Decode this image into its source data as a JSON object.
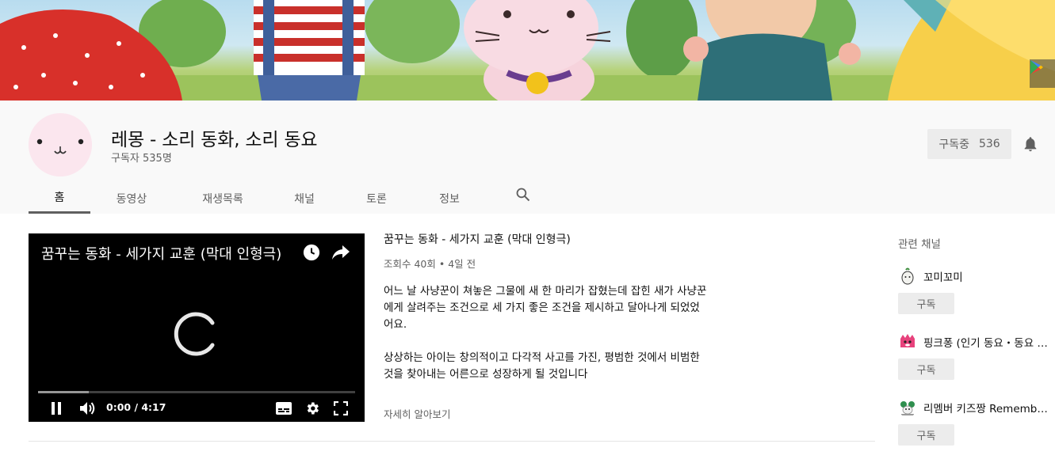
{
  "channel": {
    "name": "레몽 - 소리 동화, 소리 동요",
    "subscribers": "구독자 535명",
    "subscribe_label": "구독중",
    "subscribe_count": "536"
  },
  "tabs": [
    {
      "label": "홈",
      "active": true
    },
    {
      "label": "동영상"
    },
    {
      "label": "재생목록"
    },
    {
      "label": "채널"
    },
    {
      "label": "토론"
    },
    {
      "label": "정보"
    }
  ],
  "player": {
    "title": "꿈꾸는 동화 - 세가지 교훈 (막대 인형극)",
    "time": "0:00 / 4:17",
    "progress": 0.16
  },
  "video": {
    "title": "꿈꾸는 동화 - 세가지 교훈 (막대 인형극)",
    "meta": "조회수 40회 • 4일 전",
    "description": [
      "어느 날 사냥꾼이 쳐놓은 그물에 새 한 마리가 잡혔는데 잡힌 새가 사냥꾼에게 살려주는 조건으로 세 가지 좋은 조건을 제시하고 달아나게 되었었어요.",
      "상상하는 아이는 창의적이고 다각적 사고를 가진, 평범한 것에서 비범한 것을 찾아내는 어른으로 성장하게 될 것입니다"
    ],
    "more": "자세히 알아보기"
  },
  "related": {
    "title": "관련 채널",
    "items": [
      {
        "name": "꼬미꼬미",
        "button": "구독"
      },
      {
        "name": "핑크퐁 (인기 동요・동요 모음)",
        "button": "구독"
      },
      {
        "name": "리멤버 키즈짱 Remember Kids",
        "button": "구독"
      }
    ]
  },
  "icons": [
    "play-store-icon",
    "bell-icon",
    "search-icon",
    "watch-later-icon",
    "share-icon",
    "loading-spinner-icon",
    "pause-icon",
    "volume-icon",
    "subtitles-icon",
    "settings-icon",
    "fullscreen-icon"
  ],
  "colors": {
    "header_bg": "#f9f9f9",
    "player_bg": "#000000",
    "avatar_bg": "#fbe6ee",
    "button_bg": "#ececec"
  }
}
